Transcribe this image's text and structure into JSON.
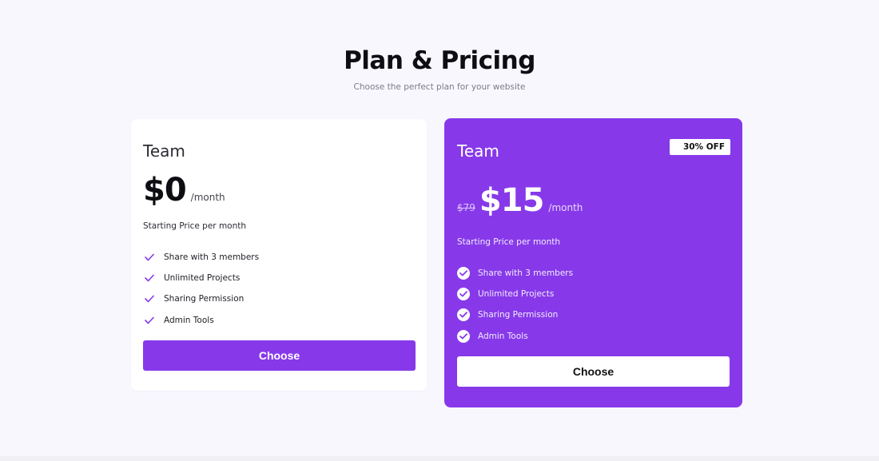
{
  "header": {
    "title": "Plan & Pricing",
    "subtitle": "Choose the perfect plan for your website"
  },
  "colors": {
    "accent": "#8739EA",
    "background": "#F9F7FE",
    "card": "#FFFFFF"
  },
  "plans": [
    {
      "name": "Team",
      "price": "$0",
      "period": "/month",
      "caption": "Starting Price per month",
      "features": [
        {
          "label": "Share with 3 members",
          "icon": "check-icon"
        },
        {
          "label": "Unlimited Projects",
          "icon": "check-icon"
        },
        {
          "label": "Sharing Permission",
          "icon": "check-icon"
        },
        {
          "label": "Admin Tools",
          "icon": "check-icon"
        }
      ],
      "button_label": "Choose",
      "highlighted": false
    },
    {
      "name": "Team",
      "badge": "30% OFF",
      "old_price": "$79",
      "price": "$15",
      "period": "/month",
      "caption": "Starting Price per month",
      "features": [
        {
          "label": "Share with 3 members",
          "icon": "check-circle-icon"
        },
        {
          "label": "Unlimited Projects",
          "icon": "check-circle-icon"
        },
        {
          "label": "Sharing Permission",
          "icon": "check-circle-icon"
        },
        {
          "label": "Admin Tools",
          "icon": "check-circle-icon"
        }
      ],
      "button_label": "Choose",
      "highlighted": true
    }
  ]
}
